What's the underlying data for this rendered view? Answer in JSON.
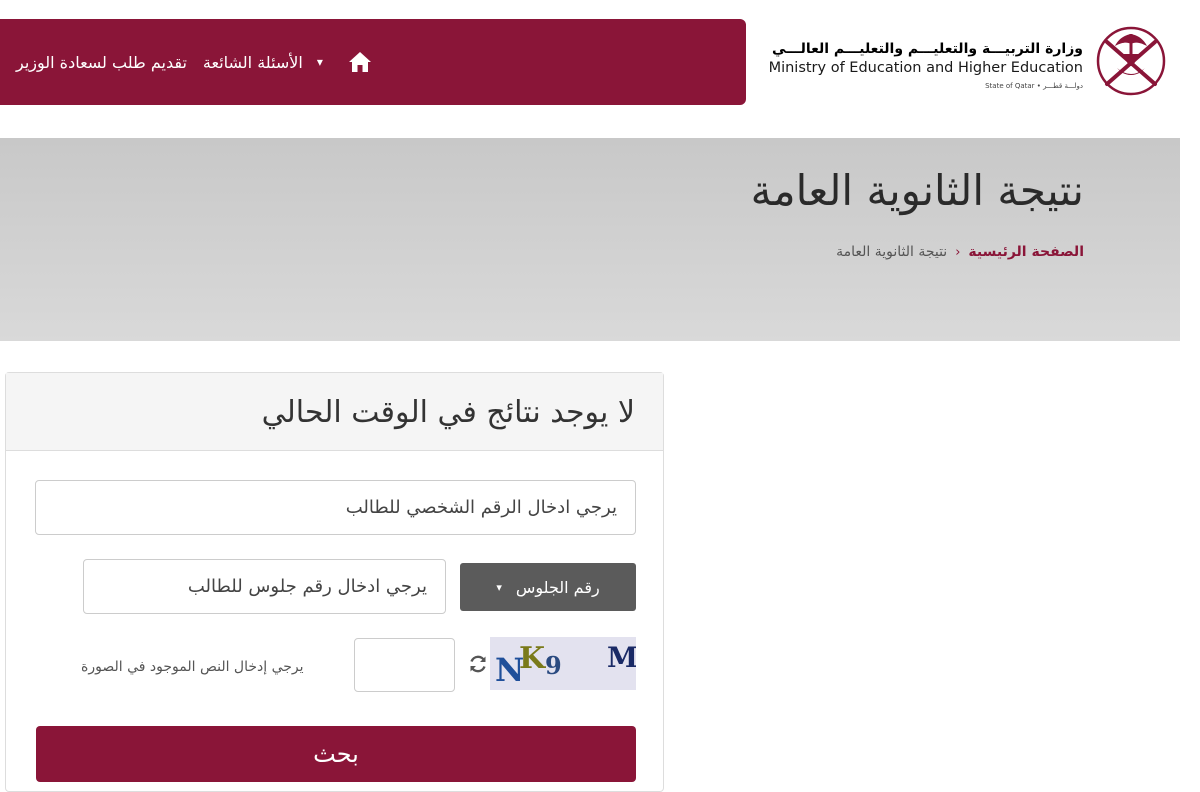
{
  "nav": {
    "home_icon": "home-icon",
    "menu_caret": "▾",
    "links": [
      "الأسئلة الشائعة",
      "تقديم طلب لسعادة الوزير"
    ]
  },
  "logo": {
    "arabic": "وزارة التربيـــة والتعليـــم والتعليـــم العالـــي",
    "english": "Ministry of Education and Higher Education",
    "state": "State of Qatar • دولـــة قطـــر"
  },
  "banner": {
    "title": "نتيجة الثانوية العامة",
    "breadcrumb_home": "الصفحة الرئيسية",
    "breadcrumb_current": "نتيجة الثانوية العامة"
  },
  "card": {
    "title": "لا يوجد نتائج في الوقت الحالي",
    "id_placeholder": "يرجي ادخال الرقم الشخصي للطالب",
    "seat_dropdown": "رقم الجلوس",
    "seat_placeholder": "يرجي ادخال رقم جلوس للطالب",
    "captcha_hint": "يرجي إدخال النص الموجود في الصورة",
    "captcha_chars": [
      "N",
      "K",
      "9",
      "M"
    ],
    "search_button": "بحث"
  },
  "colors": {
    "brand": "#8a1538",
    "dropdown": "#5b5b5b",
    "banner": "#d0d0d0"
  }
}
